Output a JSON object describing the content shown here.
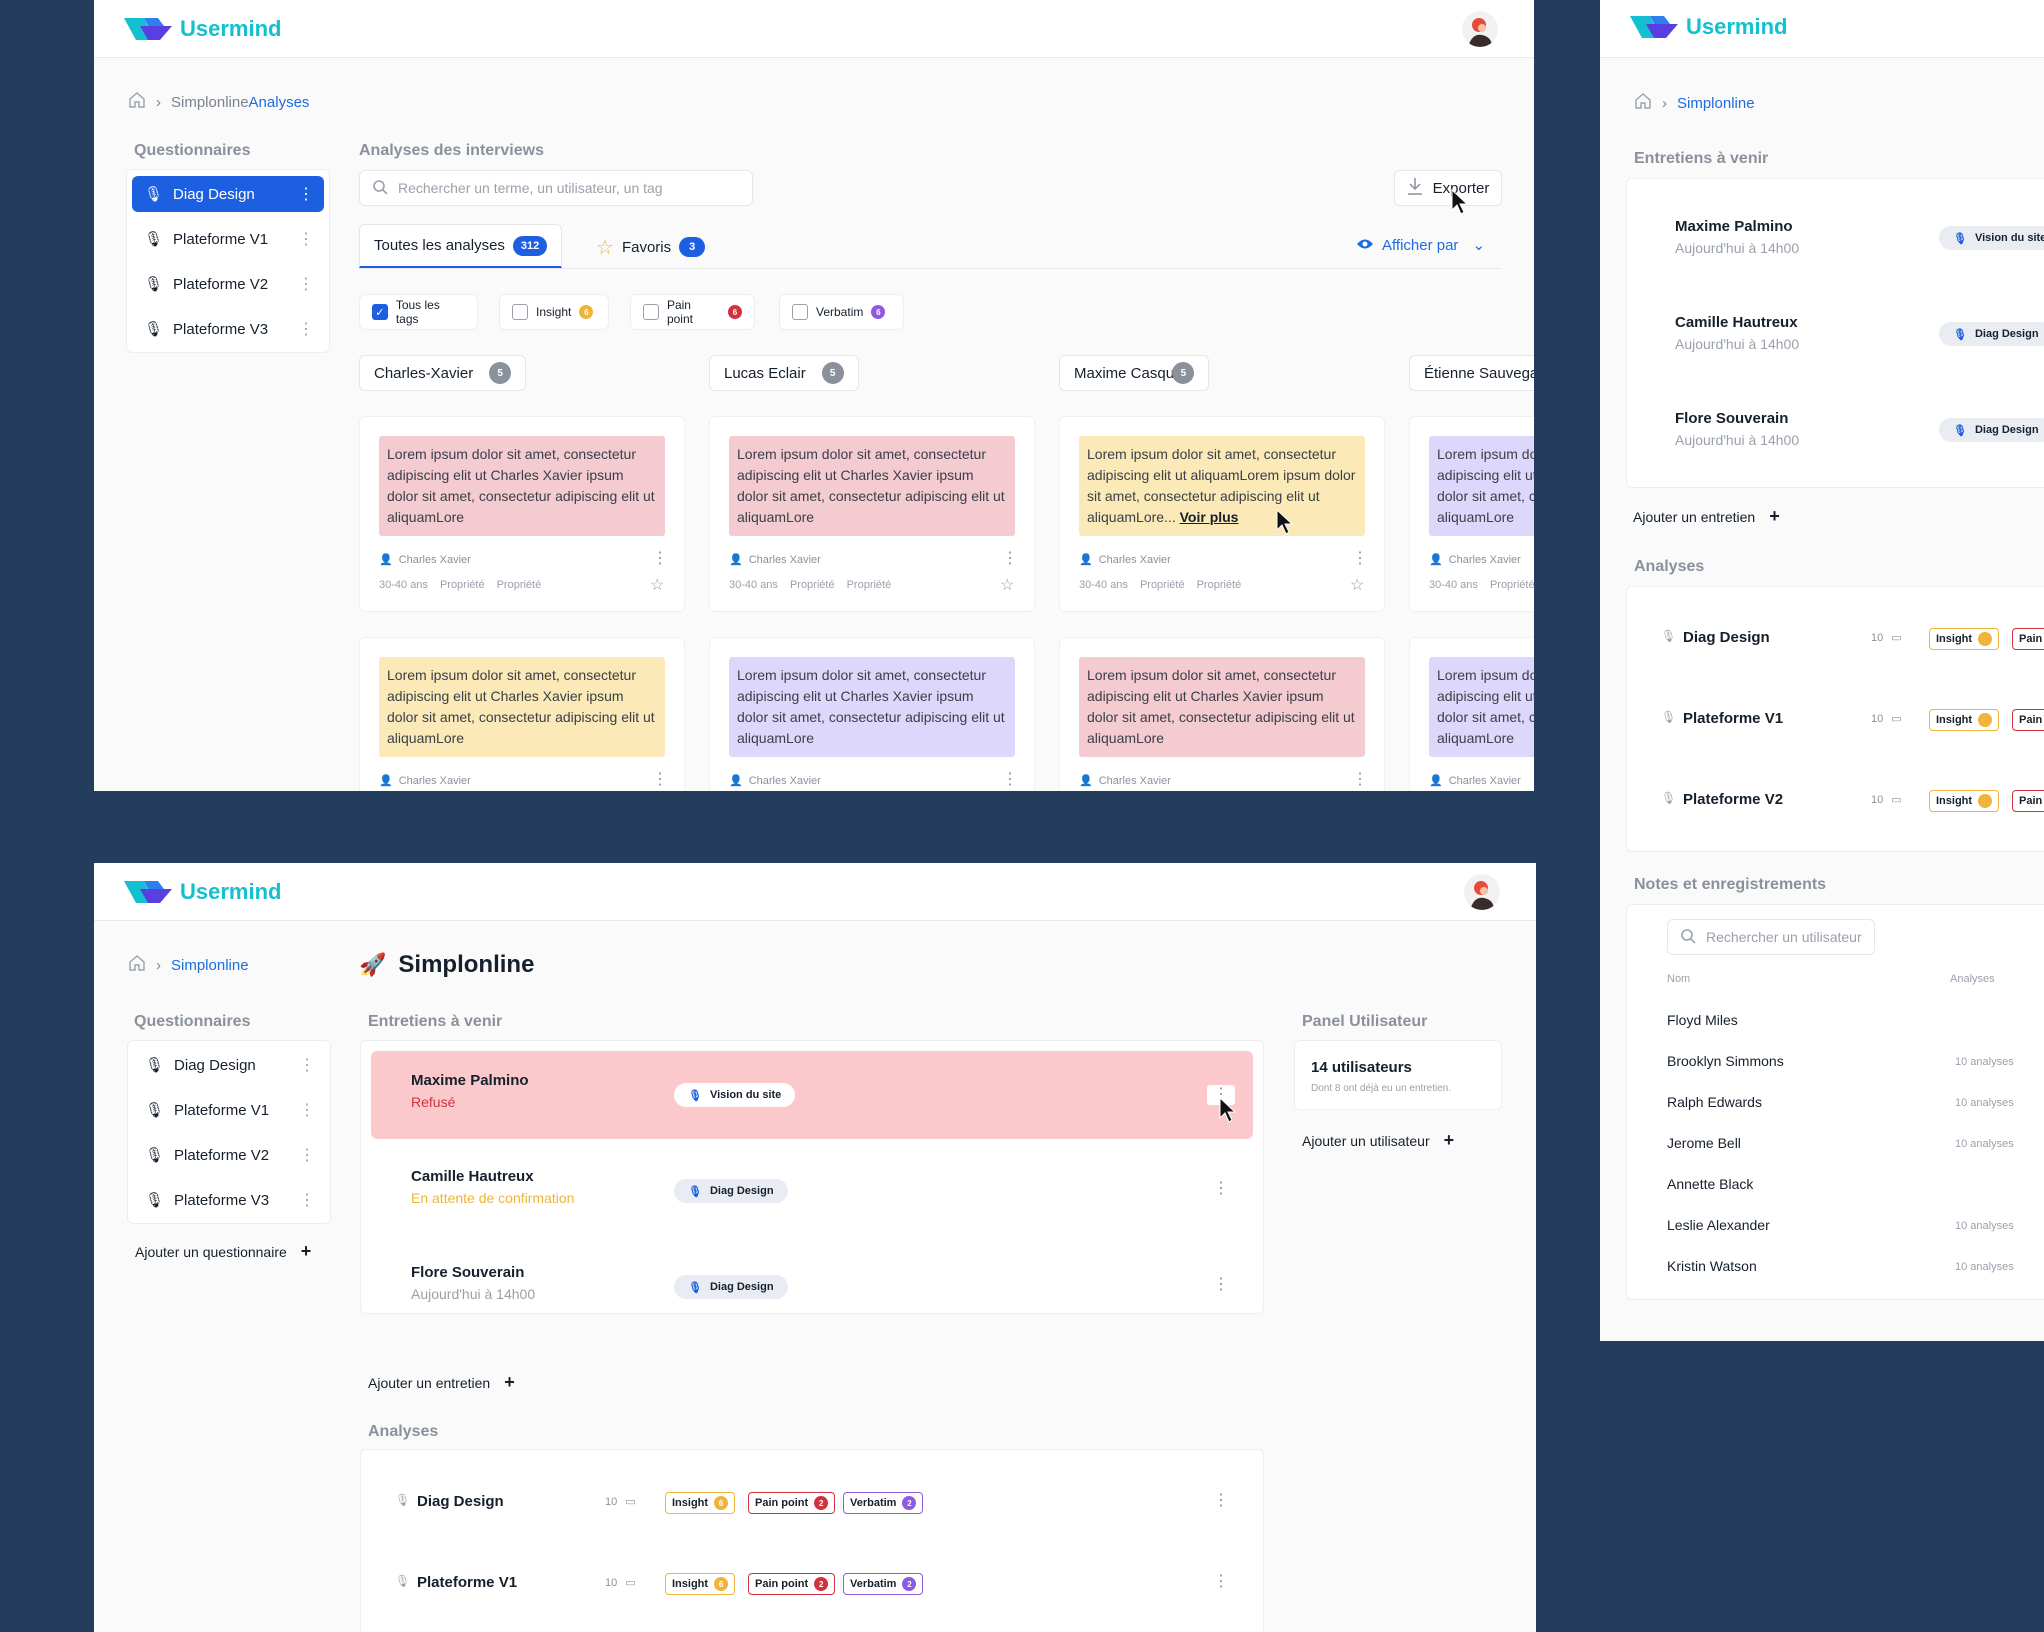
{
  "brand": {
    "name": "Usermind"
  },
  "w1": {
    "breadcrumb": {
      "parent": "Simplonline",
      "current": "Analyses"
    },
    "questionnaires_title": "Questionnaires",
    "questionnaires": [
      "Diag Design",
      "Plateforme V1",
      "Plateforme V2",
      "Plateforme V3"
    ],
    "analyses_title": "Analyses des interviews",
    "search_placeholder": "Rechercher un terme, un utilisateur, un tag",
    "export_label": "Exporter",
    "tabs": [
      {
        "label": "Toutes les analyses",
        "count": "312"
      },
      {
        "label": "Favoris",
        "count": "3"
      }
    ],
    "display_by": "Afficher par",
    "filters": [
      {
        "label": "Tous les tags",
        "checked": true
      },
      {
        "label": "Insight",
        "count": "6",
        "color": "#f0b43a"
      },
      {
        "label": "Pain point",
        "count": "6",
        "color": "#d0333f"
      },
      {
        "label": "Verbatim",
        "count": "6",
        "color": "#8e5be0"
      }
    ],
    "people": [
      {
        "name": "Charles-Xavier",
        "count": "5"
      },
      {
        "name": "Lucas Eclair",
        "count": "5"
      },
      {
        "name": "Maxime Casque",
        "count": "5"
      },
      {
        "name": "Étienne Sauvegarde",
        "count": ""
      }
    ],
    "note_short": "Lorem ipsum dolor sit amet, consectetur adipiscing elit ut Charles Xavier ipsum dolor sit amet, consectetur adipiscing elit ut aliquamLore",
    "note_long_a": "Lorem ipsum dolor sit amet, consectetur adipiscing elit ut aliquamLorem ipsum dolor sit amet, consectetur adipiscing elit ut aliquamLore...",
    "note_more": "Voir plus",
    "note_clip": "Lorem ipsum dolor sit amet, consectetur adipiscing elit ut Charles Xavier ipsum dolor sit amet, consectetur adipiscing elit ut aliquamLore",
    "author": "Charles Xavier",
    "age": "30-40 ans",
    "prop": "Propriété"
  },
  "w2": {
    "breadcrumb": {
      "parent": "Simplonline"
    },
    "page_title": "Simplonline",
    "questionnaires_title": "Questionnaires",
    "questionnaires": [
      "Diag Design",
      "Plateforme V1",
      "Plateforme V2",
      "Plateforme V3"
    ],
    "add_questionnaire": "Ajouter un questionnaire",
    "interviews_title": "Entretiens à venir",
    "interviews": [
      {
        "name": "Maxime Palmino",
        "status": "Refusé",
        "chip": "Vision du site"
      },
      {
        "name": "Camille Hautreux",
        "status": "En attente de confirmation",
        "chip": "Diag Design"
      },
      {
        "name": "Flore Souverain",
        "status": "Aujourd'hui à 14h00",
        "chip": "Diag Design"
      }
    ],
    "add_interview": "Ajouter un entretien",
    "analyses_title": "Analyses",
    "analyses": [
      {
        "name": "Diag Design",
        "count": "10"
      },
      {
        "name": "Plateforme V1",
        "count": "10"
      }
    ],
    "tag_labels": {
      "insight": "Insight",
      "pain": "Pain point",
      "verbatim": "Verbatim"
    },
    "tag_counts": {
      "insight": "6",
      "pain": "2",
      "verbatim": "2"
    },
    "panel_title": "Panel Utilisateur",
    "panel_users": "14 utilisateurs",
    "panel_sub": "Dont 8 ont déjà eu un entretien.",
    "add_user": "Ajouter un utilisateur"
  },
  "w3": {
    "breadcrumb": {
      "parent": "Simplonline"
    },
    "interviews_title": "Entretiens à venir",
    "interviews": [
      {
        "name": "Maxime Palmino",
        "status": "Aujourd'hui à 14h00",
        "chip": "Vision du site"
      },
      {
        "name": "Camille Hautreux",
        "status": "Aujourd'hui à 14h00",
        "chip": "Diag Design"
      },
      {
        "name": "Flore Souverain",
        "status": "Aujourd'hui à 14h00",
        "chip": "Diag Design"
      }
    ],
    "add_interview": "Ajouter un entretien",
    "analyses_title": "Analyses",
    "analyses": [
      {
        "name": "Diag Design",
        "count": "10"
      },
      {
        "name": "Plateforme V1",
        "count": "10"
      },
      {
        "name": "Plateforme V2",
        "count": "10"
      }
    ],
    "tag_insight": "Insight",
    "tag_pain": "Pain",
    "notes_title": "Notes et enregistrements",
    "search_placeholder": "Rechercher un utilisateur",
    "col_name": "Nom",
    "col_analyses": "Analyses",
    "users": [
      {
        "name": "Floyd Miles",
        "count": ""
      },
      {
        "name": "Brooklyn Simmons",
        "count": "10 analyses"
      },
      {
        "name": "Ralph Edwards",
        "count": "10 analyses"
      },
      {
        "name": "Jerome Bell",
        "count": "10 analyses"
      },
      {
        "name": "Annette Black",
        "count": ""
      },
      {
        "name": "Leslie Alexander",
        "count": "10 analyses"
      },
      {
        "name": "Kristin Watson",
        "count": "10 analyses"
      }
    ]
  }
}
